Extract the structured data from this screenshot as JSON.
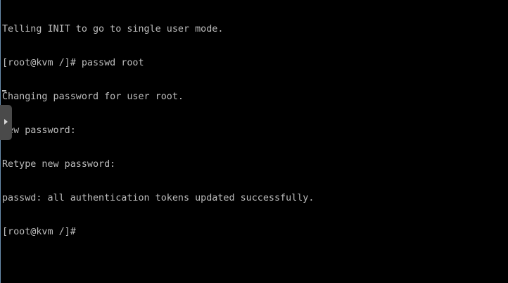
{
  "terminal": {
    "lines": [
      "Telling INIT to go to single user mode.",
      "[root@kvm /]# passwd root",
      "Changing password for user root.",
      "New password:",
      "Retype new password:",
      "passwd: all authentication tokens updated successfully.",
      "[root@kvm /]#"
    ]
  },
  "side_panel_toggle": {
    "icon": "chevron-right-icon"
  },
  "colors": {
    "background": "#000000",
    "text": "#bdbdbd",
    "toggle": "#4a4a4a"
  }
}
